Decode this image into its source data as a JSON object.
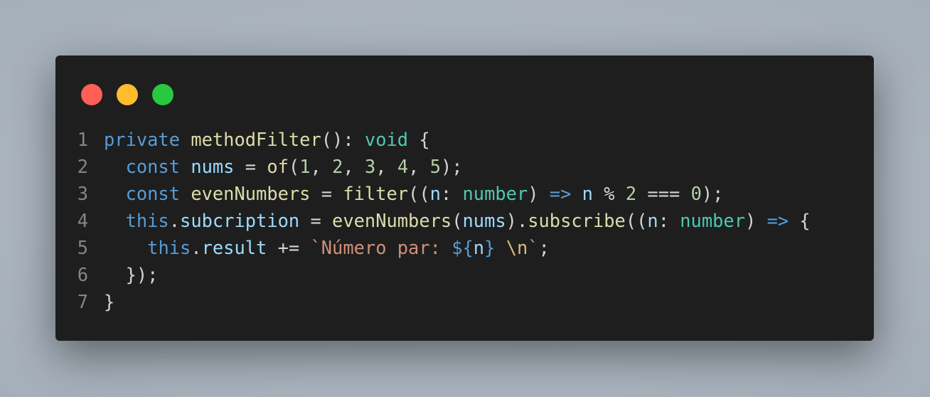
{
  "window_controls": [
    {
      "name": "close",
      "color": "#ff5f57"
    },
    {
      "name": "minimize",
      "color": "#febc2e"
    },
    {
      "name": "maximize",
      "color": "#28c840"
    }
  ],
  "colors": {
    "keyword": "#569cd6",
    "function": "#dcdcaa",
    "type": "#4ec9b0",
    "variable": "#9cdcfe",
    "number": "#b5cea8",
    "string": "#ce9178",
    "escape": "#d7ba7d",
    "punct": "#d4d4d4",
    "window_bg": "#1e1e1e",
    "line_number": "#858585"
  },
  "lines": [
    {
      "number": "1",
      "tokens": [
        [
          "private",
          "keyword"
        ],
        [
          " ",
          "punct"
        ],
        [
          "methodFilter",
          "function"
        ],
        [
          "(): ",
          "punct"
        ],
        [
          "void",
          "type"
        ],
        [
          " {",
          "punct"
        ]
      ]
    },
    {
      "number": "2",
      "tokens": [
        [
          "  ",
          "punct"
        ],
        [
          "const",
          "keyword"
        ],
        [
          " ",
          "punct"
        ],
        [
          "nums",
          "variable"
        ],
        [
          " = ",
          "punct"
        ],
        [
          "of",
          "function"
        ],
        [
          "(",
          "punct"
        ],
        [
          "1",
          "number"
        ],
        [
          ", ",
          "punct"
        ],
        [
          "2",
          "number"
        ],
        [
          ", ",
          "punct"
        ],
        [
          "3",
          "number"
        ],
        [
          ", ",
          "punct"
        ],
        [
          "4",
          "number"
        ],
        [
          ", ",
          "punct"
        ],
        [
          "5",
          "number"
        ],
        [
          ");",
          "punct"
        ]
      ]
    },
    {
      "number": "3",
      "tokens": [
        [
          "  ",
          "punct"
        ],
        [
          "const",
          "keyword"
        ],
        [
          " ",
          "punct"
        ],
        [
          "evenNumbers",
          "function"
        ],
        [
          " = ",
          "punct"
        ],
        [
          "filter",
          "function"
        ],
        [
          "((",
          "punct"
        ],
        [
          "n",
          "variable"
        ],
        [
          ": ",
          "punct"
        ],
        [
          "number",
          "type"
        ],
        [
          ") ",
          "punct"
        ],
        [
          "=>",
          "keyword"
        ],
        [
          " ",
          "punct"
        ],
        [
          "n",
          "variable"
        ],
        [
          " % ",
          "punct"
        ],
        [
          "2",
          "number"
        ],
        [
          " === ",
          "punct"
        ],
        [
          "0",
          "number"
        ],
        [
          ");",
          "punct"
        ]
      ]
    },
    {
      "number": "4",
      "tokens": [
        [
          "  ",
          "punct"
        ],
        [
          "this",
          "keyword"
        ],
        [
          ".",
          "punct"
        ],
        [
          "subcription",
          "variable"
        ],
        [
          " = ",
          "punct"
        ],
        [
          "evenNumbers",
          "function"
        ],
        [
          "(",
          "punct"
        ],
        [
          "nums",
          "variable"
        ],
        [
          ").",
          "punct"
        ],
        [
          "subscribe",
          "function"
        ],
        [
          "((",
          "punct"
        ],
        [
          "n",
          "variable"
        ],
        [
          ": ",
          "punct"
        ],
        [
          "number",
          "type"
        ],
        [
          ") ",
          "punct"
        ],
        [
          "=>",
          "keyword"
        ],
        [
          " {",
          "punct"
        ]
      ]
    },
    {
      "number": "5",
      "tokens": [
        [
          "    ",
          "punct"
        ],
        [
          "this",
          "keyword"
        ],
        [
          ".",
          "punct"
        ],
        [
          "result",
          "variable"
        ],
        [
          " += ",
          "punct"
        ],
        [
          "`Número par: ",
          "string"
        ],
        [
          "${",
          "keyword"
        ],
        [
          "n",
          "variable"
        ],
        [
          "}",
          "keyword"
        ],
        [
          " ",
          "string"
        ],
        [
          "\\n",
          "escape"
        ],
        [
          "`",
          "string"
        ],
        [
          ";",
          "punct"
        ]
      ]
    },
    {
      "number": "6",
      "tokens": [
        [
          "  });",
          "punct"
        ]
      ]
    },
    {
      "number": "7",
      "tokens": [
        [
          "}",
          "punct"
        ]
      ]
    }
  ]
}
